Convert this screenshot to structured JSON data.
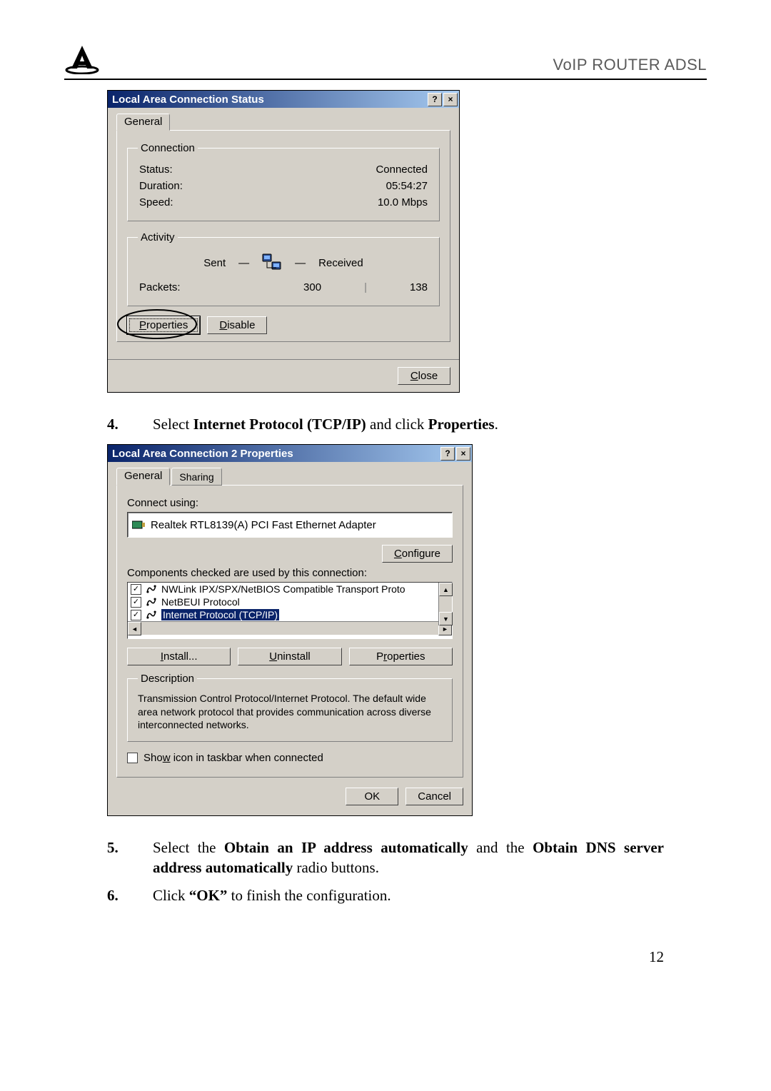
{
  "header": {
    "title": "VoIP ROUTER ADSL"
  },
  "win1": {
    "title": "Local Area Connection Status",
    "help_btn": "?",
    "close_btn": "×",
    "tab_general": "General",
    "connection_legend": "Connection",
    "status_label": "Status:",
    "status_value": "Connected",
    "duration_label": "Duration:",
    "duration_value": "05:54:27",
    "speed_label": "Speed:",
    "speed_value": "10.0 Mbps",
    "activity_legend": "Activity",
    "sent_label": "Sent",
    "received_label": "Received",
    "packets_label": "Packets:",
    "packets_sent": "300",
    "packets_received": "138",
    "properties_btn": "Properties",
    "disable_btn": "Disable",
    "close_btn_label": "Close"
  },
  "step4": {
    "num": "4.",
    "pre": "Select ",
    "bold1": "Internet Protocol (TCP/IP)",
    "mid": " and click ",
    "bold2": "Properties",
    "post": "."
  },
  "win2": {
    "title": "Local Area Connection 2 Properties",
    "help_btn": "?",
    "close_btn": "×",
    "tab_general": "General",
    "tab_sharing": "Sharing",
    "connect_using_label": "Connect using:",
    "adapter": "Realtek RTL8139(A) PCI Fast Ethernet Adapter",
    "configure_btn": "Configure",
    "components_label": "Components checked are used by this connection:",
    "items": [
      "NWLink IPX/SPX/NetBIOS Compatible Transport Proto",
      "NetBEUI Protocol",
      "Internet Protocol (TCP/IP)"
    ],
    "install_btn": "Install...",
    "uninstall_btn": "Uninstall",
    "properties_btn": "Properties",
    "description_legend": "Description",
    "description_text": "Transmission Control Protocol/Internet Protocol. The default wide area network protocol that provides communication across diverse interconnected networks.",
    "show_icon_label": "Show icon in taskbar when connected",
    "ok_btn": "OK",
    "cancel_btn": "Cancel"
  },
  "step5": {
    "num": "5.",
    "t1": "Select the ",
    "b1": "Obtain an IP address automatically",
    "t2": " and the ",
    "b2": "Obtain DNS server address automatically",
    "t3": " radio buttons."
  },
  "step6": {
    "num": "6.",
    "t1": "Click ",
    "b1": "“OK”",
    "t2": " to finish the configuration."
  },
  "page_number": "12"
}
